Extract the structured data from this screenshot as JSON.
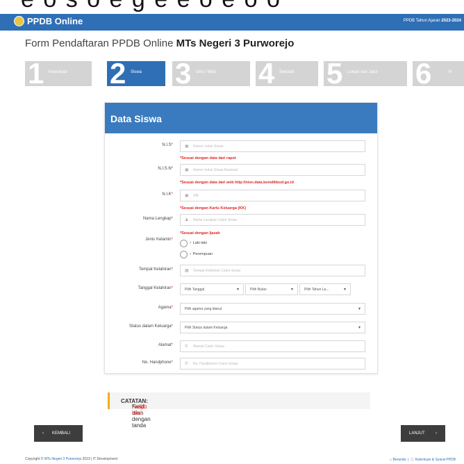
{
  "partial_heading": "e o s  o  e g  e     e  o   e o  o",
  "navbar": {
    "brand": "PPDB Online",
    "year_label": "PPDB Tahun Ajaran",
    "year_value": "2023-2024"
  },
  "page_title": {
    "prefix": "Form Pendaftaran PPDB Online",
    "school": "MTs Negeri 3 Purworejo"
  },
  "steps": [
    {
      "num": "1",
      "label": "Ketentuan"
    },
    {
      "num": "2",
      "label": "Siswa"
    },
    {
      "num": "3",
      "label": "Ortu / Wali"
    },
    {
      "num": "4",
      "label": "Sekolah"
    },
    {
      "num": "5",
      "label": "Lokasi dan Jalur"
    },
    {
      "num": "6",
      "label": "N"
    }
  ],
  "form": {
    "heading": "Data Siswa",
    "nis": {
      "label": "N.I.S",
      "placeholder": "Nomor Induk Siswa"
    },
    "nis_hint": "*Sesuai dengan data dari rapot",
    "nisn": {
      "label": "N.I.S.N",
      "placeholder": "Nomor Induk Siswa Nasional"
    },
    "nisn_hint": "*Sesuai dengan data dari web http://nisn.data.kemdikbud.go.id",
    "nik": {
      "label": "N.I.K",
      "placeholder": "NIK"
    },
    "nik_hint": "*Sesuai dengan Kartu Keluarga (KK)",
    "nama": {
      "label": "Nama Lengkap",
      "placeholder": "Nama Lengkap Calon Siswa"
    },
    "nama_hint": "*Sesuai dengan Ijazah",
    "gender": {
      "label": "Jenis Kelamin",
      "male": "Laki-laki",
      "female": "Perempuan"
    },
    "tempat": {
      "label": "Tempat Kelahiran",
      "placeholder": "Tempat Kelahiran Calon Siswa"
    },
    "tanggal": {
      "label": "Tanggal Kelahiran",
      "day": "Pilih Tanggal",
      "month": "Pilih Bulan",
      "year": "Pilih Tahun La..."
    },
    "agama": {
      "label": "Agama",
      "placeholder": "Pilih agama yang dianut"
    },
    "status": {
      "label": "Status dalam Keluarga",
      "placeholder": "Pilih Status dalam Keluarga"
    },
    "alamat": {
      "label": "Alamat",
      "placeholder": "Alamat Calon Siswa"
    },
    "hp": {
      "label": "No. Handphone",
      "placeholder": "No. Handphone Calon Siswa"
    }
  },
  "note": {
    "prefix": "CATATAN:",
    "text": " Field isian dengan tanda ",
    "required": "*wajib diisi."
  },
  "buttons": {
    "back": "KEMBALI",
    "next": "LANJUT"
  },
  "footer": {
    "copyright": "Copyright © ",
    "school": "MTs Negeri 3 Purworejo",
    "rest": " 2023 | IT Development",
    "link_home": "Beranda",
    "link_terms": "Ketentuan & Syarat PPDB"
  },
  "colors": {
    "primary": "#2f6fb5",
    "required": "#e02424",
    "note_border": "#f0ad1e"
  }
}
